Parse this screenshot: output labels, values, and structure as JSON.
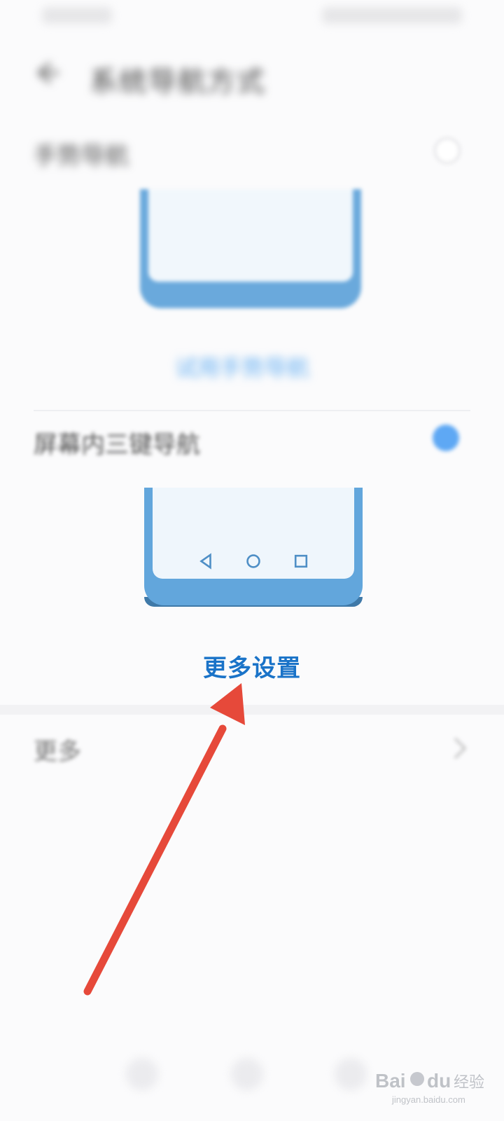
{
  "title_bar": {
    "title": "系统导航方式"
  },
  "options": [
    {
      "label": "手势导航",
      "selected": false,
      "link": "试用手势导航"
    },
    {
      "label": "屏幕内三键导航",
      "selected": true,
      "link": "更多设置"
    }
  ],
  "more_row": {
    "label": "更多"
  },
  "colors": {
    "accent": "#1a73c8",
    "radio_on": "#5ea8f4",
    "arrow": "#e6493a",
    "mock_blue": "#62a6dc"
  },
  "watermark": {
    "brand": "Baidu经验",
    "site": "jingyan.baidu.com"
  }
}
